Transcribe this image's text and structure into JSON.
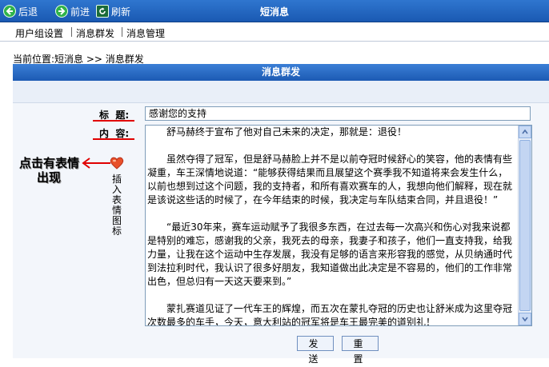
{
  "toolbar": {
    "back_label": "后退",
    "forward_label": "前进",
    "refresh_label": "刷新",
    "title": "短消息"
  },
  "menu": {
    "items": [
      "用户组设置",
      "消息群发",
      "消息管理"
    ]
  },
  "breadcrumb": "当前位置:短消息 >> 消息群发",
  "panel": {
    "header": "消息群发"
  },
  "form": {
    "title_label": "标  题:",
    "title_value": "感谢您的支持",
    "content_label": "内  容:",
    "content_paragraphs": [
      "舒马赫终于宣布了他对自己未来的决定，那就是：退役！",
      "虽然夺得了冠军，但是舒马赫脸上并不是以前夺冠时候舒心的笑容，他的表情有些凝重，车王深情地说道：“能够获得结果而且展望这个赛季我不知道将来会发生什么，以前也想到过这个问题，我的支持者，和所有喜欢赛车的人，我想向他们解释，现在就是该说这些话的时候了，在今年结束的时候，我决定与车队结束合同，并且退役！”",
      "“最近30年来，赛车运动赋予了我很多东西，在过去每一次高兴和伤心对我来说都是特别的难忘，感谢我的父亲，我死去的母亲，我妻子和孩子，他们一直支持我，给我力量，让我在这个运动中生存发展，我没有足够的语言来形容我的感觉，从贝纳通时代到法拉利时代，我认识了很多好朋友，我知道做出此决定是不容易的，他们的工作非常出色，但总归有一天这天要来到。”",
      "蒙扎赛道见证了一代车王的辉煌，而五次在蒙扎夺冠的历史也让舒米成为这里夺冠次数最多的车手，今天，意大利站的冠军将是车王最完美的道别礼！"
    ],
    "emoticon_label": "插入表情图标",
    "annotation_line1": "点击有表情",
    "annotation_line2": "出现"
  },
  "buttons": {
    "send": "发送",
    "reset": "重置"
  },
  "colors": {
    "header_blue": "#1c5ab3",
    "annotation_red": "#e00000",
    "heart": "#e8502a"
  }
}
